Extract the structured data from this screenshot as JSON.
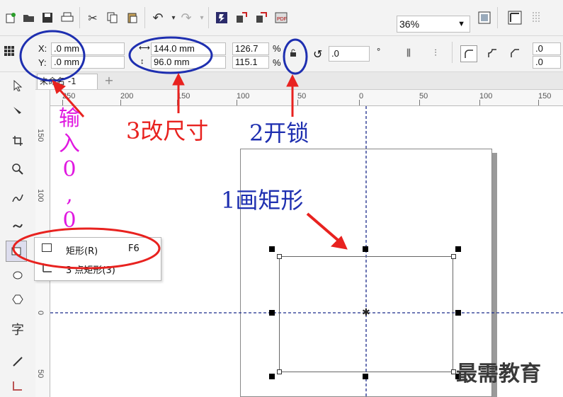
{
  "toolbar": {
    "icons": [
      "new-icon",
      "open-icon",
      "save-icon",
      "print-icon",
      "cut-icon",
      "copy-icon",
      "paste-icon",
      "undo-icon",
      "redo-icon",
      "publish-icon",
      "import-icon",
      "export-icon",
      "pdf-icon",
      "zoom-to-fit-icon",
      "rulers-icon",
      "grid-icon"
    ],
    "zoom_value": "36%"
  },
  "properties": {
    "x_label": "X:",
    "x_value": ".0 mm",
    "y_label": "Y:",
    "y_value": ".0 mm",
    "width_value": "144.0 mm",
    "height_value": "96.0 mm",
    "scale_w": "126.7",
    "scale_h": "115.1",
    "percent": "%",
    "rotation_value": ".0",
    "degree": "°",
    "corner_value_1": ".0",
    "corner_value_2": ".0"
  },
  "document": {
    "tab_label": "未命名 -1",
    "add_tab": "+"
  },
  "rulers": {
    "h_ticks": [
      "250",
      "200",
      "150",
      "100",
      "50",
      "0",
      "50",
      "100",
      "150"
    ],
    "v_ticks": [
      "150",
      "100",
      "50",
      "0",
      "50"
    ]
  },
  "flyout": {
    "items": [
      {
        "label": "矩形(R)",
        "shortcut": "F6"
      },
      {
        "label": "3 点矩形(3)",
        "shortcut": ""
      }
    ]
  },
  "annotations": {
    "step1": "1画矩形",
    "step2": "2开锁",
    "step3": "3改尺寸",
    "input_chars": [
      "输",
      "入",
      "0",
      ",",
      "0"
    ]
  },
  "watermark": "最需教育",
  "colors": {
    "annotation_red": "#e8221f",
    "annotation_blue": "#1e2fb0",
    "annotation_magenta": "#e018e0",
    "guide": "#1a2a8a"
  }
}
